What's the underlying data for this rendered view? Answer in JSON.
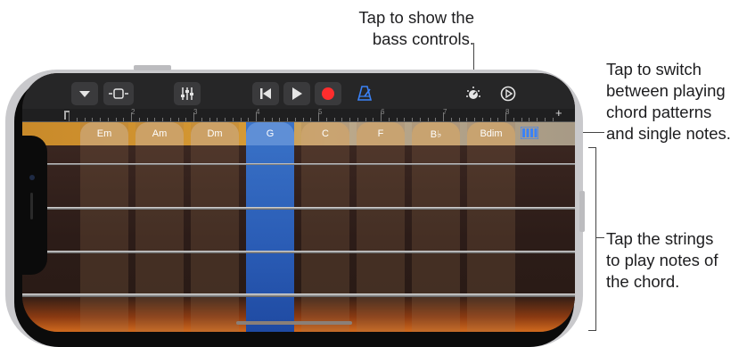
{
  "callouts": {
    "bass_controls": [
      "Tap to show the",
      "bass controls."
    ],
    "switch_mode": [
      "Tap to switch",
      "between playing",
      "chord patterns",
      "and single notes."
    ],
    "strings": [
      "Tap the strings",
      "to play notes of",
      "the chord."
    ]
  },
  "toolbar": {
    "icons": [
      "browser-dropdown-icon",
      "track-view-icon",
      "mixer-icon",
      "go-to-beginning-icon",
      "play-icon",
      "record-icon",
      "metronome-icon",
      "bass-controls-icon",
      "settings-icon"
    ]
  },
  "ruler": {
    "bars": [
      "2",
      "3",
      "4",
      "5",
      "6",
      "7",
      "8"
    ],
    "add_label": "+"
  },
  "chords": [
    {
      "label": "Em"
    },
    {
      "label": "Am"
    },
    {
      "label": "Dm"
    },
    {
      "label": "G"
    },
    {
      "label": "C"
    },
    {
      "label": "F"
    },
    {
      "label": "B♭"
    },
    {
      "label": "Bdim"
    }
  ],
  "active_chord": "G",
  "colors": {
    "record": "#ff2d2d",
    "metronome": "#3b82f6",
    "active_chord": "#3a73c8",
    "mode_switch": "#3b82f6"
  }
}
